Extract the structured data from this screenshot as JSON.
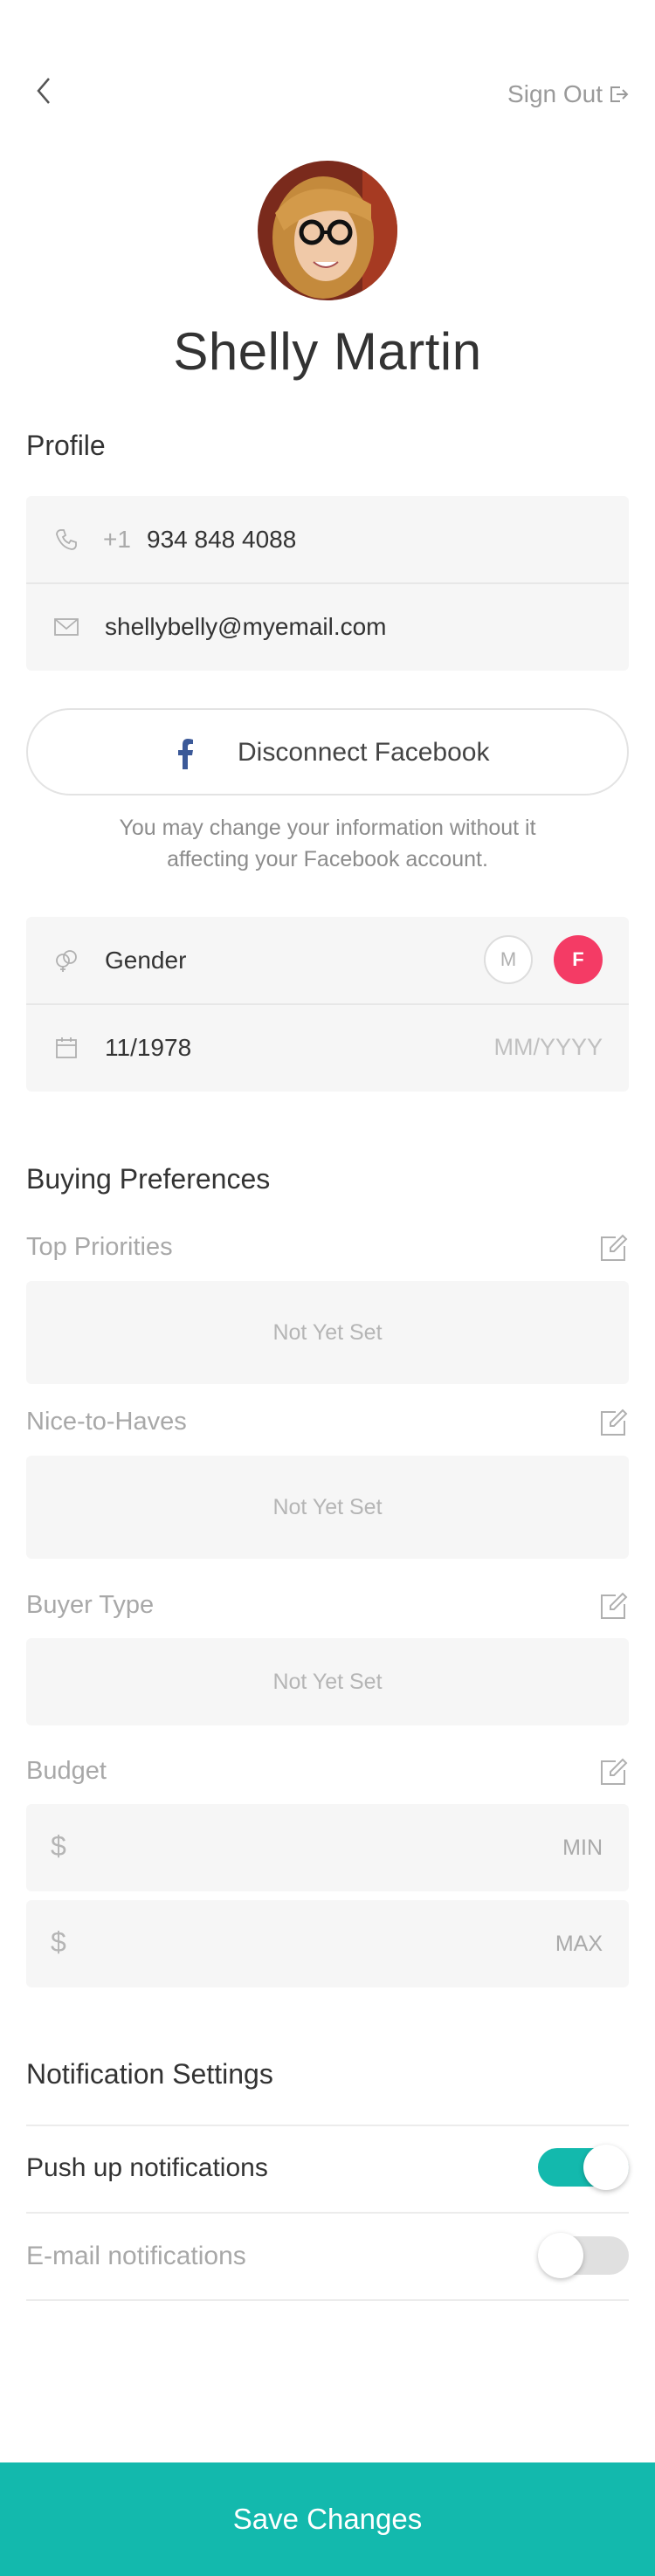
{
  "header": {
    "back_icon": "chevron-left-icon",
    "sign_out_label": "Sign Out",
    "sign_out_icon": "sign-out-icon"
  },
  "user": {
    "name": "Shelly Martin"
  },
  "profile": {
    "title": "Profile",
    "phone_prefix": "+1",
    "phone": "934 848 4088",
    "email": "shellybelly@myemail.com"
  },
  "facebook": {
    "button_label": "Disconnect Facebook",
    "note": "You may change your information without it affecting your Facebook account."
  },
  "personal": {
    "gender_label": "Gender",
    "gender_male": "M",
    "gender_female": "F",
    "gender_selected": "F",
    "birth_value": "11/1978",
    "birth_placeholder": "MM/YYYY"
  },
  "buying_preferences": {
    "title": "Buying Preferences",
    "top_priorities": {
      "label": "Top Priorities",
      "value": "Not Yet Set"
    },
    "nice_to_haves": {
      "label": "Nice-to-Haves",
      "value": "Not Yet Set"
    },
    "buyer_type": {
      "label": "Buyer Type",
      "value": "Not Yet Set"
    },
    "budget": {
      "label": "Budget",
      "currency": "$",
      "min_placeholder": "MIN",
      "max_placeholder": "MAX"
    }
  },
  "notifications": {
    "title": "Notification Settings",
    "push": {
      "label": "Push up notifications",
      "enabled": true
    },
    "email": {
      "label": "E-mail notifications",
      "enabled": false
    }
  },
  "footer": {
    "save_label": "Save Changes"
  },
  "colors": {
    "accent": "#13b9ad",
    "female_selected": "#f43b65",
    "facebook": "#3b5998"
  }
}
